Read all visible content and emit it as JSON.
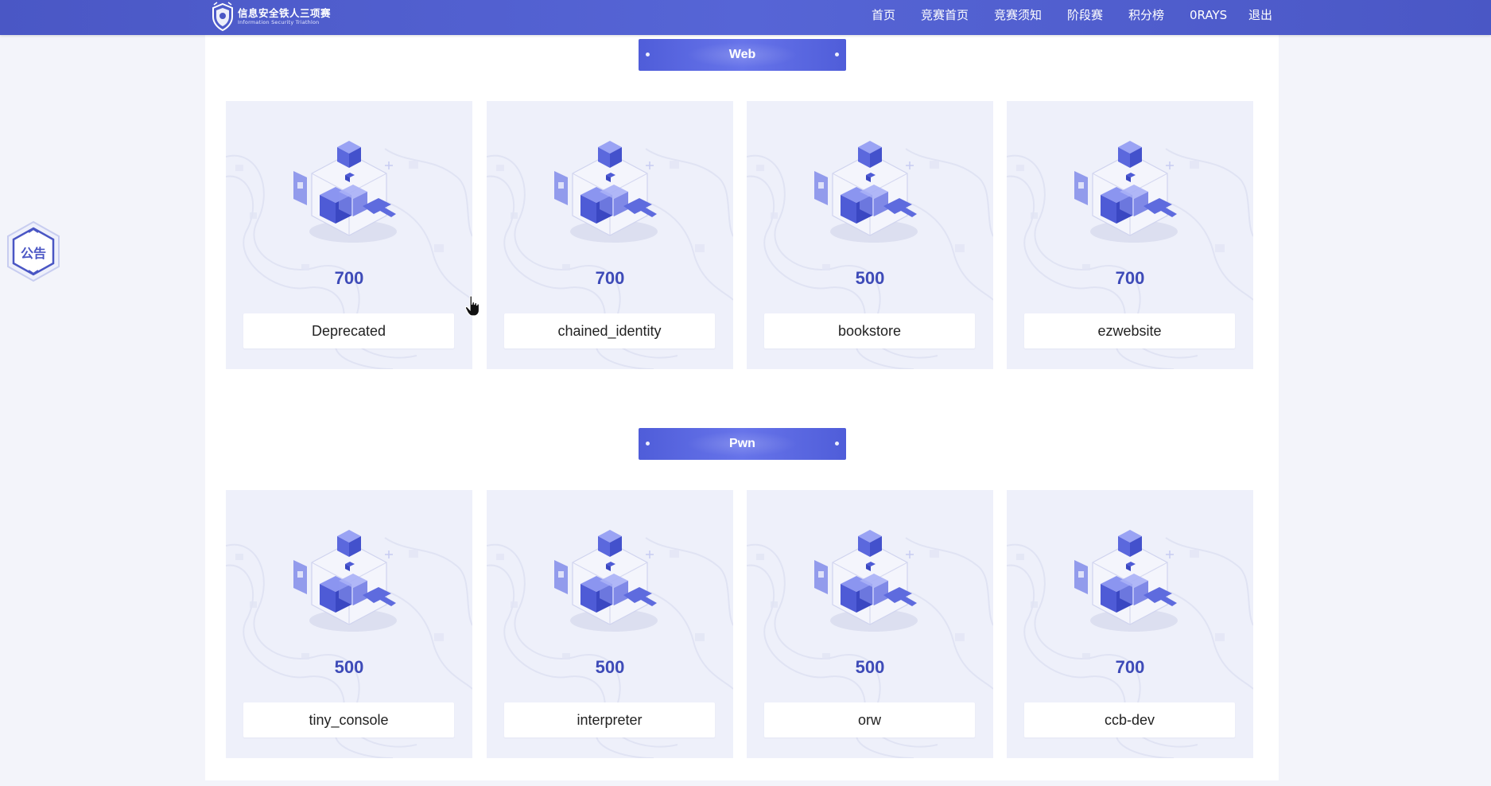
{
  "header": {
    "logo_cn": "信息安全铁人三项赛",
    "logo_en": "Information Security Triathlon",
    "nav": [
      "首页",
      "竞赛首页",
      "竞赛须知",
      "阶段赛",
      "积分榜",
      "0RAYS",
      "退出"
    ]
  },
  "announcement": {
    "label": "公告"
  },
  "sections": [
    {
      "title": "Web",
      "challenges": [
        {
          "points": "700",
          "name": "Deprecated"
        },
        {
          "points": "700",
          "name": "chained_identity"
        },
        {
          "points": "500",
          "name": "bookstore"
        },
        {
          "points": "700",
          "name": "ezwebsite"
        }
      ]
    },
    {
      "title": "Pwn",
      "challenges": [
        {
          "points": "500",
          "name": "tiny_console"
        },
        {
          "points": "500",
          "name": "interpreter"
        },
        {
          "points": "500",
          "name": "orw"
        },
        {
          "points": "700",
          "name": "ccb-dev"
        }
      ]
    }
  ],
  "colors": {
    "nav_bg": "#4a57c5",
    "accent": "#3e4bb8",
    "card_bg": "#eef0fa",
    "banner": "#5a67de"
  },
  "icons": {
    "logo": "shield-emblem-icon",
    "card_art": "isometric-cube-icon",
    "announce": "hexagon-badge-icon",
    "cursor": "hand-pointer-icon"
  }
}
